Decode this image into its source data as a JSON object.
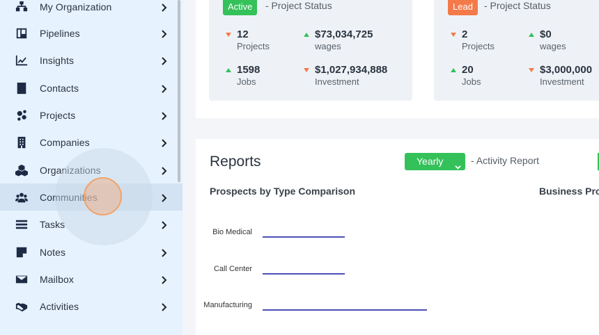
{
  "sidebar": {
    "items": [
      {
        "label": "My Organization",
        "icon": "org-chart-icon"
      },
      {
        "label": "Pipelines",
        "icon": "pipeline-icon"
      },
      {
        "label": "Insights",
        "icon": "line-chart-icon"
      },
      {
        "label": "Contacts",
        "icon": "contact-card-icon"
      },
      {
        "label": "Projects",
        "icon": "gears-icon"
      },
      {
        "label": "Companies",
        "icon": "building-icon"
      },
      {
        "label": "Organizations",
        "icon": "cubes-icon"
      },
      {
        "label": "Communities",
        "icon": "users-icon"
      },
      {
        "label": "Tasks",
        "icon": "tasks-icon"
      },
      {
        "label": "Notes",
        "icon": "note-icon"
      },
      {
        "label": "Mailbox",
        "icon": "envelope-icon"
      },
      {
        "label": "Activities",
        "icon": "handshake-icon"
      }
    ],
    "active_item": "Communities"
  },
  "cards": [
    {
      "badge": "Active",
      "status": "- Project Status",
      "stats": [
        {
          "value": "12",
          "label": "Projects",
          "trend": "down"
        },
        {
          "value": "$73,034,725",
          "label": "wages",
          "trend": "up"
        },
        {
          "value": "1598",
          "label": "Jobs",
          "trend": "up"
        },
        {
          "value": "$1,027,934,888",
          "label": "Investment",
          "trend": "down"
        }
      ]
    },
    {
      "badge": "Lead",
      "status": "- Project Status",
      "stats": [
        {
          "value": "2",
          "label": "Projects",
          "trend": "down"
        },
        {
          "value": "$0",
          "label": "wages",
          "trend": "up"
        },
        {
          "value": "20",
          "label": "Jobs",
          "trend": "up"
        },
        {
          "value": "$3,000,000",
          "label": "Investment",
          "trend": "down"
        }
      ]
    }
  ],
  "reports": {
    "title": "Reports",
    "period": "Yearly",
    "activity_label": "- Activity Report",
    "chart_title": "Prospects by Type Comparison",
    "chart2_title": "Business Pro"
  },
  "colors": {
    "accent_green": "#34c15a",
    "accent_orange": "#f47a4a",
    "bar_color": "#4a4fb3"
  },
  "chart_data": {
    "type": "bar",
    "orientation": "horizontal",
    "title": "Prospects by Type Comparison",
    "categories": [
      "Bio Medical",
      "Call Center",
      "Manufacturing"
    ],
    "values": [
      1,
      1,
      2
    ],
    "xlim": [
      0,
      3
    ]
  }
}
